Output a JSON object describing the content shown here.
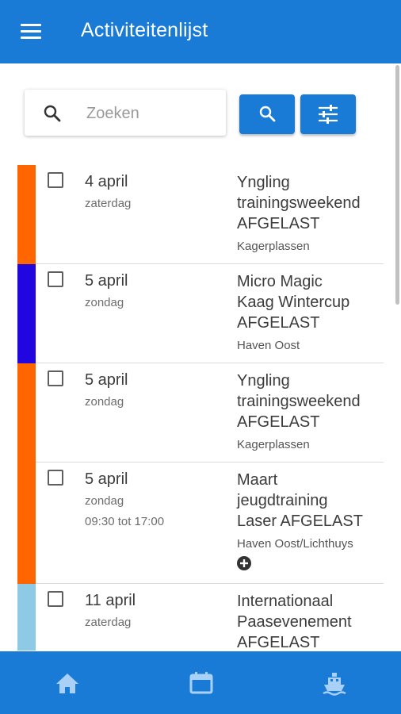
{
  "header": {
    "title": "Activiteitenlijst",
    "menu_icon": "menu-icon"
  },
  "search": {
    "placeholder": "Zoeken",
    "value": "",
    "icon": "search-icon"
  },
  "buttons": {
    "search_icon": "search-icon",
    "filter_icon": "tune-icon"
  },
  "activities": [
    {
      "date": "4 april",
      "day": "zaterdag",
      "time": "",
      "name_lines": [
        "Yngling",
        "trainingsweekend",
        "AFGELAST"
      ],
      "location": "Kagerplassen",
      "color": "#ff6600",
      "has_plus": false
    },
    {
      "date": "5 april",
      "day": "zondag",
      "time": "",
      "name_lines": [
        "Micro Magic",
        "Kaag Wintercup",
        "AFGELAST"
      ],
      "location": "Haven Oost",
      "color": "#2206e0",
      "has_plus": false
    },
    {
      "date": "5 april",
      "day": "zondag",
      "time": "",
      "name_lines": [
        "Yngling",
        "trainingsweekend",
        "AFGELAST"
      ],
      "location": "Kagerplassen",
      "color": "#ff6600",
      "has_plus": false
    },
    {
      "date": "5 april",
      "day": "zondag",
      "time": "09:30 tot 17:00",
      "name_lines": [
        "Maart",
        "jeugdtraining",
        "Laser AFGELAST"
      ],
      "location": "Haven Oost/Lichthuys",
      "color": "#ff6600",
      "has_plus": true
    },
    {
      "date": "11 april",
      "day": "zaterdag",
      "time": "",
      "name_lines": [
        "Internationaal",
        "Paasevenement",
        "AFGELAST"
      ],
      "location": "",
      "color": "#8ecae6",
      "has_plus": false
    }
  ],
  "colors": {
    "primary": "#1a7bd6",
    "nav_icon": "#a9d0f7"
  },
  "bottom_nav": [
    {
      "icon": "home-icon"
    },
    {
      "icon": "calendar-icon"
    },
    {
      "icon": "boat-icon"
    }
  ]
}
